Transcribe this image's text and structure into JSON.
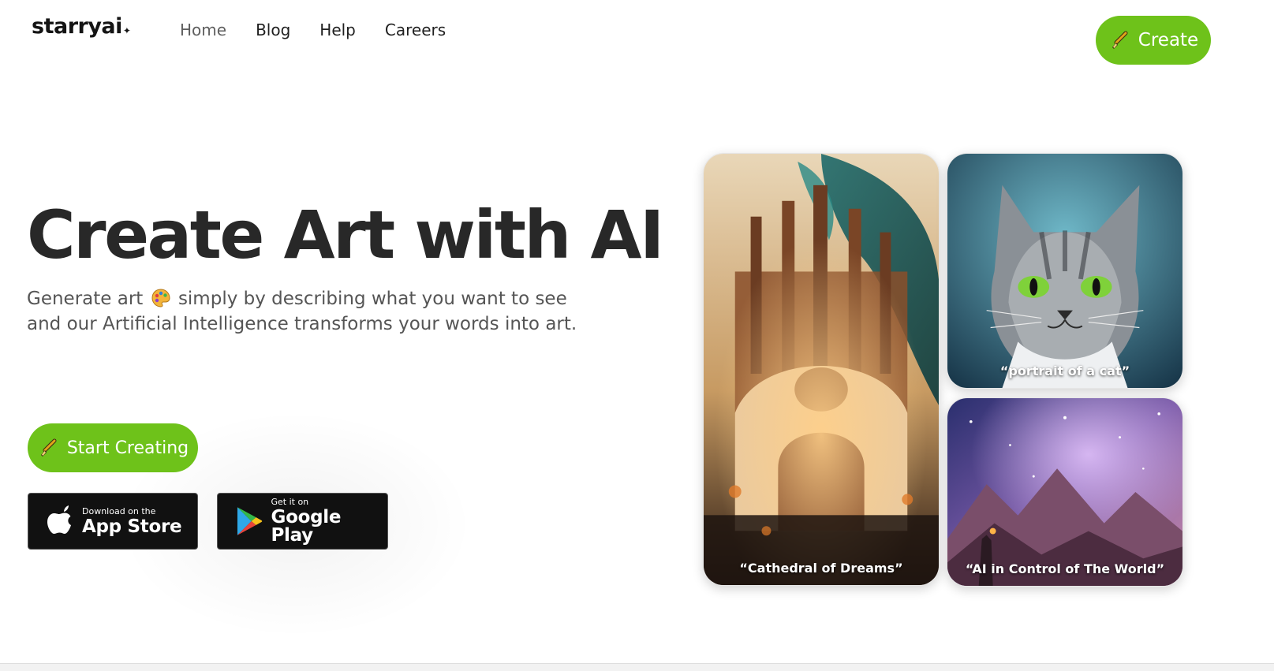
{
  "brand": {
    "name": "starryai",
    "spark": "✦"
  },
  "nav": {
    "items": [
      {
        "label": "Home",
        "active": true
      },
      {
        "label": "Blog"
      },
      {
        "label": "Help"
      },
      {
        "label": "Careers"
      }
    ]
  },
  "header": {
    "create_label": "Create"
  },
  "hero": {
    "title": "Create Art with AI",
    "subtitle_part1": "Generate art",
    "subtitle_part2": "simply by describing what you want to see and our Artificial Intelligence transforms your words into art.",
    "start_label": "Start Creating"
  },
  "stores": {
    "apple": {
      "small": "Download on the",
      "big": "App Store"
    },
    "google": {
      "small": "Get it on",
      "big": "Google Play"
    }
  },
  "gallery": [
    {
      "caption": "“Cathedral of Dreams”"
    },
    {
      "caption": "“portrait of a cat”"
    },
    {
      "caption": "“AI in Control of The World”"
    }
  ],
  "colors": {
    "accent": "#6ec21a",
    "text": "#282828",
    "subtext": "#555555",
    "store_bg": "#111111"
  },
  "icons": {
    "create": "paintbrush-icon",
    "subtitle": "artist-palette-icon",
    "apple": "apple-logo-icon",
    "google": "google-play-icon"
  }
}
